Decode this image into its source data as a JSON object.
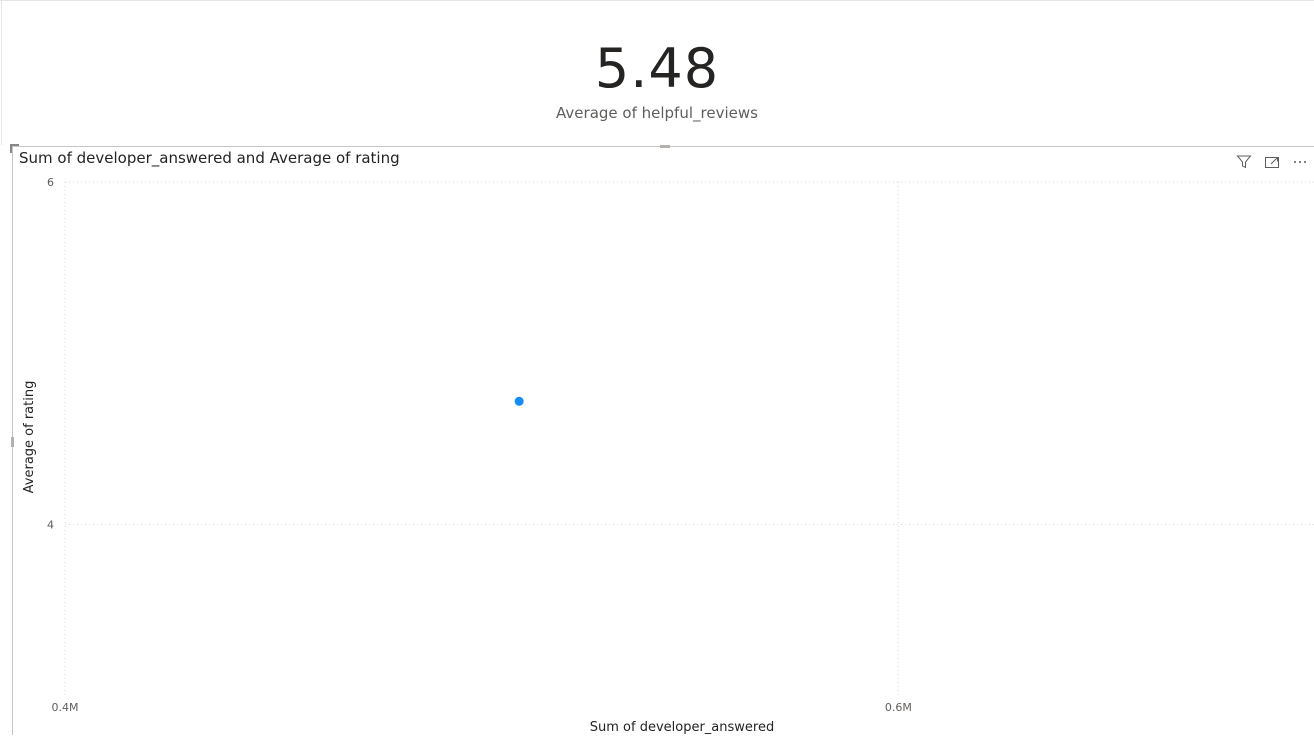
{
  "card": {
    "value": "5.48",
    "label": "Average of helpful_reviews"
  },
  "toolbar": {
    "filter_icon": "filter-icon",
    "focus_icon": "focus-mode-icon",
    "more_icon": "more-options-icon"
  },
  "chart_data": {
    "type": "scatter",
    "title": "Sum of developer_answered and Average of rating",
    "xlabel": "Sum of developer_answered",
    "ylabel": "Average of rating",
    "xlim": [
      400000,
      700000
    ],
    "ylim": [
      3,
      6
    ],
    "x_ticks": [
      400000,
      600000
    ],
    "x_tick_labels": [
      "0.4M",
      "0.6M"
    ],
    "y_ticks": [
      4,
      6
    ],
    "y_tick_labels": [
      "4",
      "6"
    ],
    "grid": true,
    "points": [
      {
        "x": 509000,
        "y": 4.72
      }
    ],
    "colors": {
      "point": "#118DFF",
      "grid": "#d9d9d9"
    }
  }
}
